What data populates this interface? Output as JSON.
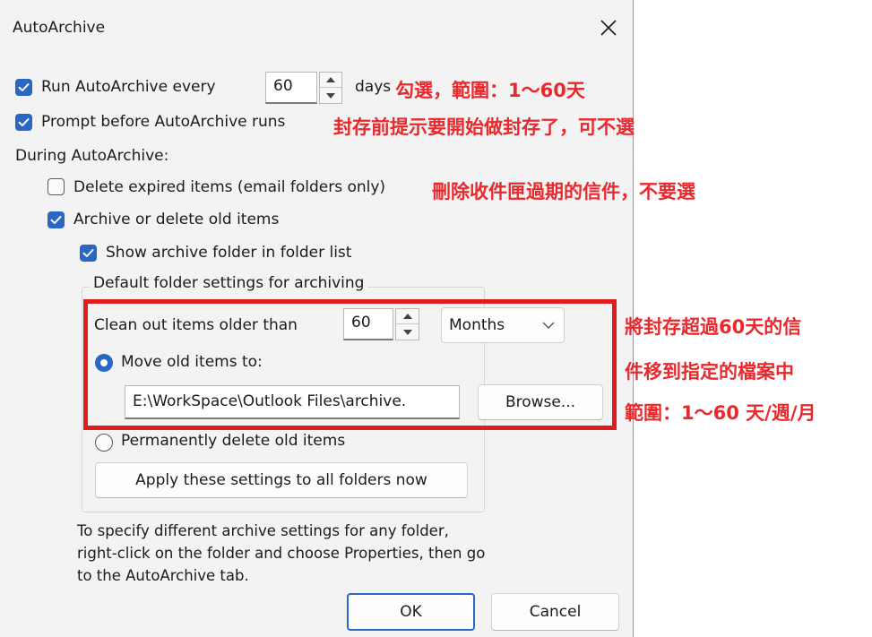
{
  "dialog": {
    "title": "AutoArchive",
    "close_glyph": "×"
  },
  "run": {
    "label": "Run AutoArchive every",
    "value": "60",
    "unit": "days",
    "checked": true
  },
  "prompt": {
    "label": "Prompt before AutoArchive runs",
    "checked": true
  },
  "during_label": "During AutoArchive:",
  "delete_expired": {
    "label": "Delete expired items (email folders only)",
    "checked": false
  },
  "archive_old": {
    "label": "Archive or delete old items",
    "checked": true
  },
  "show_folder": {
    "label": "Show archive folder in folder list",
    "checked": true
  },
  "defaults": {
    "legend": "Default folder settings for archiving",
    "clean_label": "Clean out items older than",
    "clean_value": "60",
    "period": "Months",
    "move_label": "Move old items to:",
    "move_selected": true,
    "path": "E:\\WorkSpace\\Outlook Files\\archive.",
    "browse": "Browse...",
    "perm_delete": "Permanently delete old items",
    "apply_all": "Apply these settings to all folders now"
  },
  "help_text": [
    "To specify different archive settings for any folder,",
    "right-click on the folder and choose Properties, then go",
    "to the AutoArchive tab."
  ],
  "buttons": {
    "ok": "OK",
    "cancel": "Cancel"
  },
  "annotations": {
    "run_note": "勾選，範圍：1～60天",
    "prompt_note": "封存前提示要開始做封存了，可不選",
    "expired_note": "刪除收件匣過期的信件，不要選",
    "box_note_1": "將封存超過60天的信",
    "box_note_2": "件移到指定的檔案中",
    "box_note_3": "範圍：1～60 天/週/月"
  },
  "colors": {
    "accent": "#2a67c4",
    "annotation_red": "#e01c1c",
    "dialog_bg": "#f3f3f3"
  }
}
